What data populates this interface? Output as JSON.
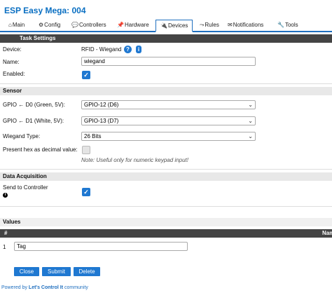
{
  "app": {
    "title": "ESP Easy Mega: 004"
  },
  "tabs": [
    {
      "icon": "⌂",
      "label": "Main"
    },
    {
      "icon": "⚙",
      "label": "Config"
    },
    {
      "icon": "💬",
      "label": "Controllers"
    },
    {
      "icon": "📌",
      "label": "Hardware"
    },
    {
      "icon": "🔌",
      "label": "Devices"
    },
    {
      "icon": "⤳",
      "label": "Rules"
    },
    {
      "icon": "✉",
      "label": "Notifications"
    },
    {
      "icon": "🔧",
      "label": "Tools"
    }
  ],
  "task_settings": {
    "header": "Task Settings",
    "device_label": "Device:",
    "device_value": "RFID - Wiegand",
    "help_label": "?",
    "info_label": "i",
    "name_label": "Name:",
    "name_value": "wiegand",
    "enabled_label": "Enabled:",
    "enabled_checked": true
  },
  "sensor": {
    "header": "Sensor",
    "gpio_d0_label": "GPIO ← D0 (Green, 5V):",
    "gpio_d0_value": "GPIO-12 (D6)",
    "gpio_d1_label": "GPIO ← D1 (White, 5V):",
    "gpio_d1_value": "GPIO-13 (D7)",
    "wiegand_type_label": "Wiegand Type:",
    "wiegand_type_value": "26 Bits",
    "present_hex_label": "Present hex as decimal value:",
    "present_hex_checked": false,
    "present_hex_note": "Note: Useful only for numeric keypad input!"
  },
  "data_acquisition": {
    "header": "Data Acquisition",
    "send_label": "Send to Controller",
    "send_checked": true
  },
  "values": {
    "header": "Values",
    "col_index": "#",
    "col_name": "Name",
    "rows": [
      {
        "index": "1",
        "name": "Tag"
      }
    ]
  },
  "buttons": {
    "close": "Close",
    "submit": "Submit",
    "delete": "Delete"
  },
  "footer": {
    "prefix": "Powered by ",
    "link": "Let's Control It",
    "suffix": " community"
  },
  "colors": {
    "accent": "#1f78d1",
    "header_dark": "#444444",
    "header_light": "#e8e8e8"
  }
}
